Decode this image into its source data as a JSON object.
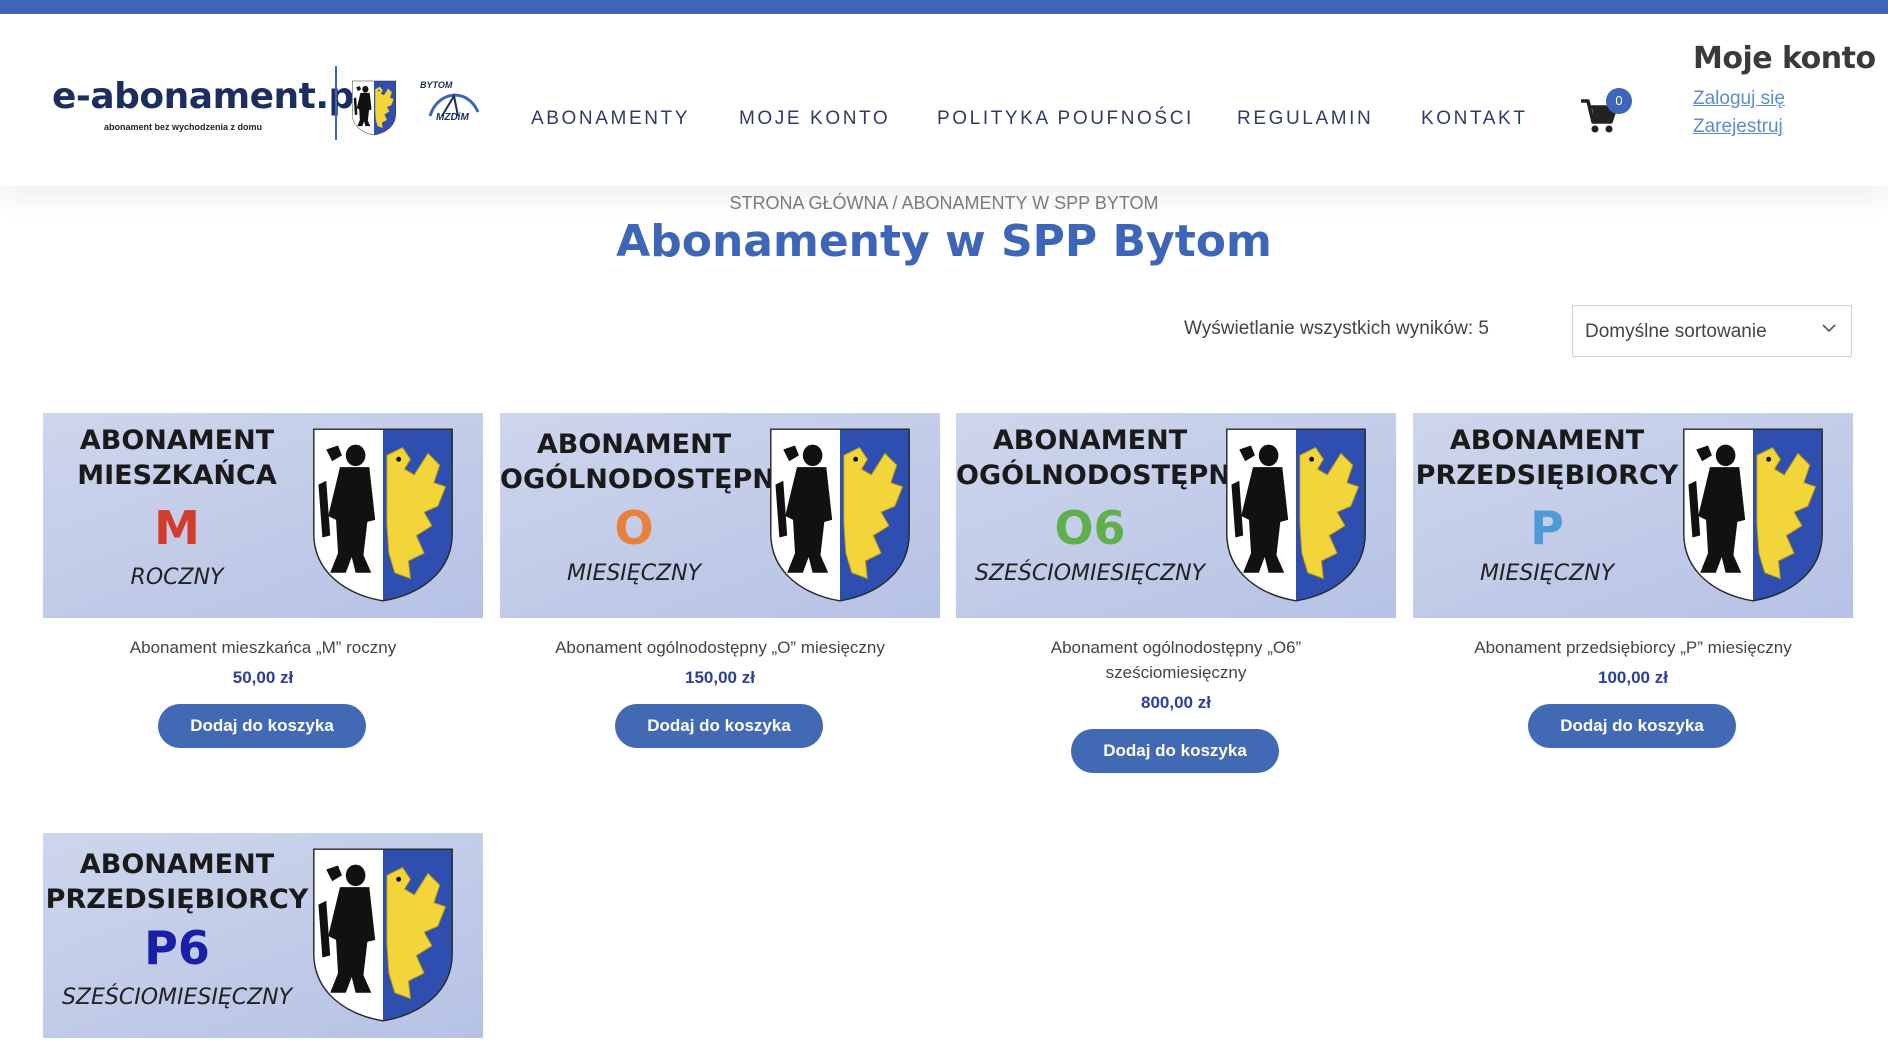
{
  "logo": {
    "text": "e-abonament.pl",
    "tagline": "abonament bez wychodzenia z domu",
    "partner_top": "BYTOM",
    "partner_bottom": "MZDiM"
  },
  "nav": {
    "items": [
      "ABONAMENTY",
      "MOJE KONTO",
      "POLITYKA POUFNOŚCI",
      "REGULAMIN",
      "KONTAKT"
    ]
  },
  "cart": {
    "count": "0"
  },
  "account": {
    "title": "Moje konto",
    "login": "Zaloguj się",
    "register": "Zarejestruj"
  },
  "breadcrumb": {
    "home": "STRONA GŁÓWNA",
    "separator": " / ",
    "current": "ABONAMENTY W SPP BYTOM"
  },
  "page_title": "Abonamenty w SPP Bytom",
  "results_text": "Wyświetlanie wszystkich wyników: 5",
  "sort": {
    "selected": "Domyślne sortowanie"
  },
  "add_to_cart_label": "Dodaj do koszyka",
  "colors": {
    "brand_blue": "#3d66b8",
    "price_blue": "#2a3fa0",
    "letter_m": "#d33b2c",
    "letter_o": "#e8823a",
    "letter_o6": "#5fb04d",
    "letter_p": "#4e9ad8",
    "letter_p6": "#1a1fa8"
  },
  "products": [
    {
      "banner_line1": "ABONAMENT",
      "banner_line2": "MIESZKAŃCA",
      "letter": "M",
      "period": "ROCZNY",
      "name": "Abonament mieszkańca „M” roczny",
      "price": "50,00 zł"
    },
    {
      "banner_line1": "ABONAMENT",
      "banner_line2": "OGÓLNODOSTĘPNY",
      "letter": "O",
      "period": "MIESIĘCZNY",
      "name": "Abonament ogólnodostępny „O” miesięczny",
      "price": "150,00 zł"
    },
    {
      "banner_line1": "ABONAMENT",
      "banner_line2": "OGÓLNODOSTĘPNY",
      "letter": "O6",
      "period": "SZEŚCIOMIESIĘCZNY",
      "name_line1": "Abonament ogólnodostępny „O6”",
      "name_line2": "sześciomiesięczny",
      "price": "800,00 zł"
    },
    {
      "banner_line1": "ABONAMENT",
      "banner_line2": "PRZEDSIĘBIORCY",
      "letter": "P",
      "period": "MIESIĘCZNY",
      "name": "Abonament przedsiębiorcy „P” miesięczny",
      "price": "100,00 zł"
    },
    {
      "banner_line1": "ABONAMENT",
      "banner_line2": "PRZEDSIĘBIORCY",
      "letter": "P6",
      "period": "SZEŚCIOMIESIĘCZNY"
    }
  ]
}
